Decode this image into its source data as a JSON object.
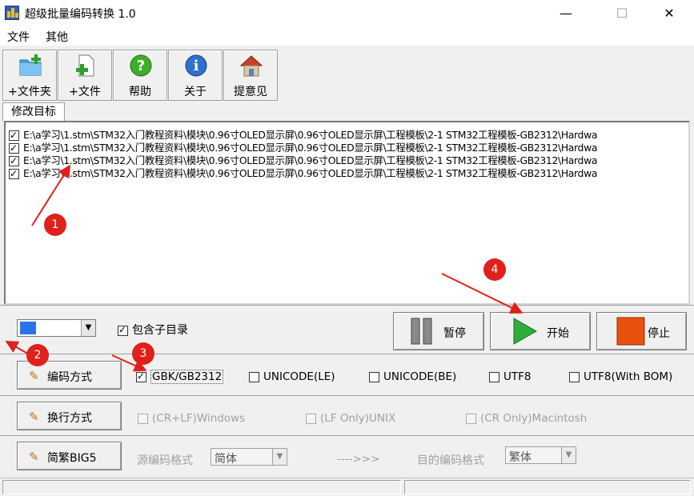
{
  "window": {
    "title": "超级批量编码转换 1.0",
    "min_glyph": "—",
    "max_glyph": "☐",
    "close_glyph": "✕"
  },
  "menu": {
    "items": [
      "文件",
      "其他"
    ]
  },
  "toolbar": {
    "buttons": [
      {
        "label": "+文件夹",
        "icon": "folder-add-icon"
      },
      {
        "label": "+文件",
        "icon": "file-add-icon"
      },
      {
        "label": "帮助",
        "icon": "help-icon"
      },
      {
        "label": "关于",
        "icon": "info-icon"
      },
      {
        "label": "提意见",
        "icon": "house-icon"
      }
    ]
  },
  "tabs": {
    "active": "修改目标"
  },
  "file_list": {
    "rows": [
      "E:\\a学习\\1.stm\\STM32入门教程资料\\模块\\0.96寸OLED显示屏\\0.96寸OLED显示屏\\工程模板\\2-1 STM32工程模板-GB2312\\Hardwa",
      "E:\\a学习\\1.stm\\STM32入门教程资料\\模块\\0.96寸OLED显示屏\\0.96寸OLED显示屏\\工程模板\\2-1 STM32工程模板-GB2312\\Hardwa",
      "E:\\a学习\\1.stm\\STM32入门教程资料\\模块\\0.96寸OLED显示屏\\0.96寸OLED显示屏\\工程模板\\2-1 STM32工程模板-GB2312\\Hardwa",
      "E:\\a学习\\1.stm\\STM32入门教程资料\\模块\\0.96寸OLED显示屏\\0.96寸OLED显示屏\\工程模板\\2-1 STM32工程模板-GB2312\\Hardwa"
    ],
    "checked": [
      true,
      true,
      true,
      true
    ]
  },
  "controls": {
    "include_subdirs": "包含子目录",
    "pause": "暂停",
    "start": "开始",
    "stop": "停止",
    "color_swatch": "#2a72e8"
  },
  "encoding": {
    "button": "编码方式",
    "options": [
      "GBK/GB2312",
      "UNICODE(LE)",
      "UNICODE(BE)",
      "UTF8",
      "UTF8(With BOM)"
    ],
    "selected": "GBK/GB2312"
  },
  "linebreak": {
    "button": "换行方式",
    "options": [
      "(CR+LF)Windows",
      "(LF Only)UNIX",
      "(CR Only)Macintosh"
    ]
  },
  "big5": {
    "button": "简繁BIG5",
    "source_label": "源编码格式",
    "source_value": "简体",
    "arrow": "---->>>",
    "target_label": "目的编码格式",
    "target_value": "繁体"
  },
  "annotations": [
    "1",
    "2",
    "3",
    "4"
  ],
  "colors": {
    "annotation": "#e0201a",
    "start_arrow": "#2fae3a",
    "stop_square": "#e8520e"
  }
}
